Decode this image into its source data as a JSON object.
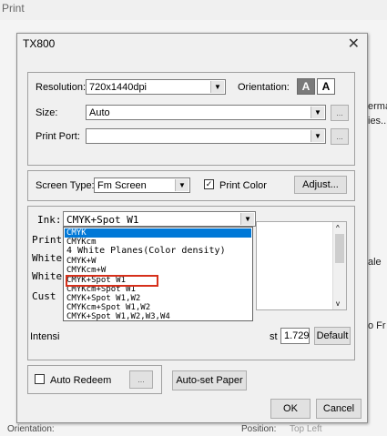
{
  "background": {
    "title": "Print",
    "right_labels": [
      "erma",
      "ies...",
      "ale",
      "o Fr"
    ],
    "orientation_text": "Orientation:",
    "position_text": "Position:",
    "position_value": "Top Left"
  },
  "dialog": {
    "title": "TX800",
    "close_glyph": "✕",
    "resolution": {
      "label": "Resolution:",
      "value": "720x1440dpi"
    },
    "orientation": {
      "label": "Orientation:",
      "portrait_glyph": "A",
      "landscape_glyph": "A"
    },
    "size": {
      "label": "Size:",
      "value": "Auto"
    },
    "print_port": {
      "label": "Print Port:",
      "value": ""
    },
    "screen_type": {
      "label": "Screen Type:",
      "value": "Fm Screen"
    },
    "print_color": {
      "label": "Print Color",
      "checked": true
    },
    "adjust_button": "Adjust...",
    "ink": {
      "label": "Ink:",
      "value": "CMYK+Spot W1",
      "options": [
        "CMYK",
        "CMYKcm",
        "4 White Planes(Color density)",
        "CMYK+W",
        "CMYKcm+W",
        "CMYK+Spot W1",
        "CMYKcm+Spot W1",
        "CMYK+Spot W1,W2",
        "CMYKcm+Spot W1,W2",
        "CMYK+Spot W1,W2,W3,W4"
      ],
      "selected_index": 0,
      "highlighted_index": 5
    },
    "side_labels": [
      "Print",
      "White",
      "White",
      "Cust"
    ],
    "intensity_label": "Intensi",
    "intensity_suffix": "st",
    "intensity_value": "1.729",
    "default_button": "Default",
    "auto_redeem": {
      "label": "Auto Redeem",
      "checked": false,
      "ellipsis": "..."
    },
    "auto_set_paper_button": "Auto-set Paper",
    "ok_button": "OK",
    "cancel_button": "Cancel",
    "ellipsis": "..."
  }
}
